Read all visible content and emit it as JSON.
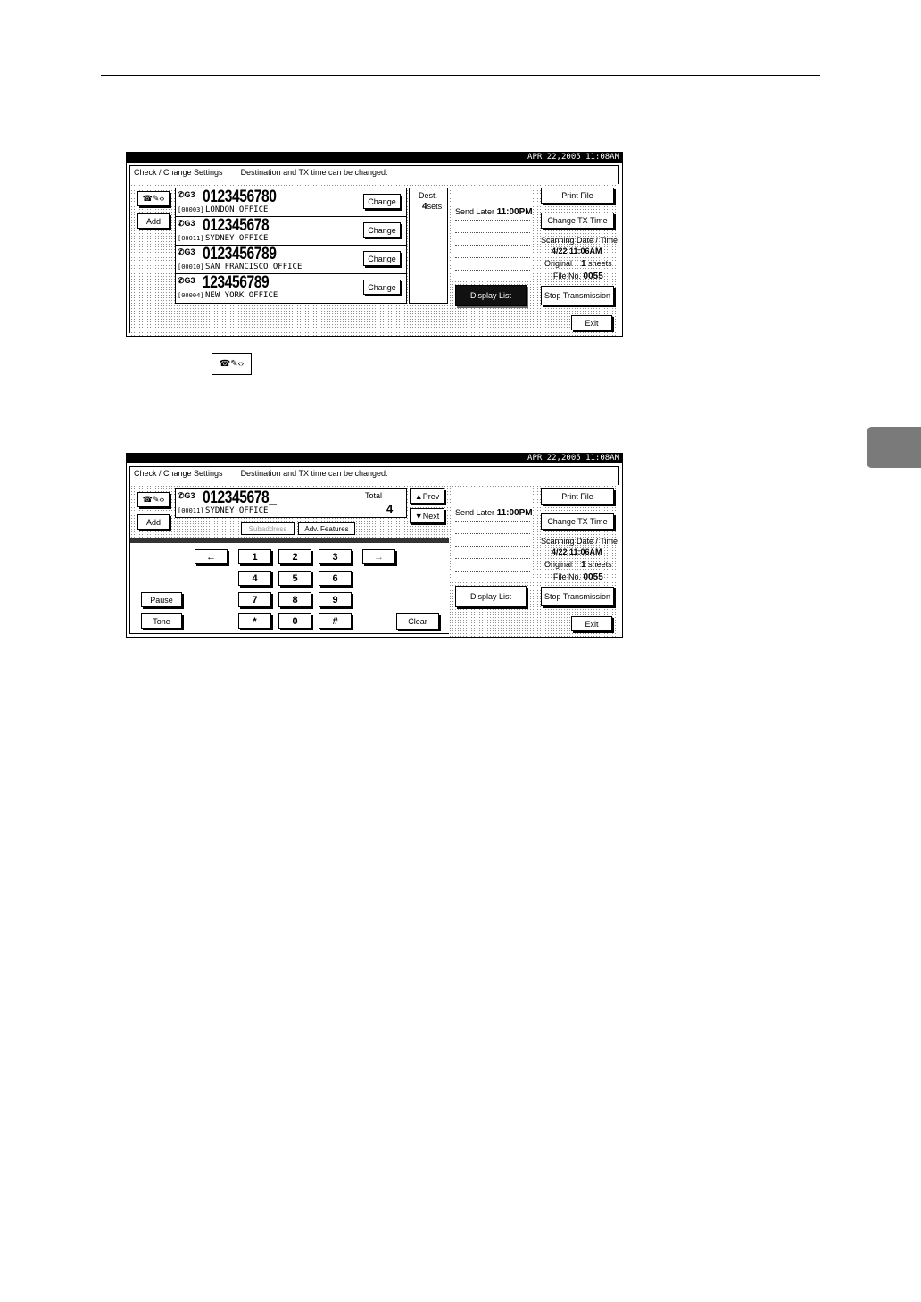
{
  "screens": [
    {
      "datetime": "APR   22,2005 11:08AM",
      "header_title": "Check / Change Settings",
      "header_message": "Destination and TX time can be changed.",
      "mode_icon": "phone-pen-arrows-icon",
      "add_label": "Add",
      "destinations": [
        {
          "badge": "G3",
          "number": "0123456780",
          "code": "[00003]",
          "name": "LONDON OFFICE",
          "change_label": "Change"
        },
        {
          "badge": "G3",
          "number": "012345678",
          "code": "[00011]",
          "name": "SYDNEY OFFICE",
          "change_label": "Change"
        },
        {
          "badge": "G3",
          "number": "0123456789",
          "code": "[00010]",
          "name": "SAN FRANCISCO OFFICE",
          "change_label": "Change"
        },
        {
          "badge": "G3",
          "number": "123456789",
          "code": "[00004]",
          "name": "NEW YORK OFFICE",
          "change_label": "Change"
        }
      ],
      "dest_label": "Dest.",
      "dest_count": "4",
      "dest_unit": "sets",
      "send_later_label": "Send Later",
      "send_later_time": "11:00PM",
      "display_list_label": "Display List",
      "print_file_label": "Print File",
      "change_tx_time_label": "Change TX Time",
      "scanning_label": "Scanning Date / Time",
      "scanning_value": "4/22  11:06AM",
      "original_label": "Original",
      "original_value": "1",
      "original_unit": "sheets",
      "file_no_label": "File No.",
      "file_no_value": "0055",
      "stop_label": "Stop Transmission",
      "exit_label": "Exit"
    },
    {
      "datetime": "APR   22,2005 11:08AM",
      "header_title": "Check / Change Settings",
      "header_message": "Destination and TX time can be changed.",
      "add_label": "Add",
      "entry_badge": "G3",
      "entry_number": "012345678_",
      "entry_code": "[00011]",
      "entry_name": "SYDNEY OFFICE",
      "total_label": "Total",
      "total_value": "4",
      "prev_label": "▲Prev",
      "next_label": "▼Next",
      "tab_sub": "Subaddress",
      "tab_adv": "Adv. Features",
      "keypad": [
        "1",
        "2",
        "3",
        "4",
        "5",
        "6",
        "7",
        "8",
        "9",
        "*",
        "0",
        "#"
      ],
      "back_arrow": "←",
      "fwd_arrow": "→",
      "pause_label": "Pause",
      "tone_label": "Tone",
      "clear_label": "Clear",
      "send_later_label": "Send Later",
      "send_later_time": "11:00PM",
      "display_list_label": "Display List",
      "print_file_label": "Print File",
      "change_tx_time_label": "Change TX Time",
      "scanning_label": "Scanning Date / Time",
      "scanning_value": "4/22  11:06AM",
      "original_label": "Original",
      "original_value": "1",
      "original_unit": "sheets",
      "file_no_label": "File No.",
      "file_no_value": "0055",
      "stop_label": "Stop Transmission",
      "exit_label": "Exit"
    }
  ]
}
